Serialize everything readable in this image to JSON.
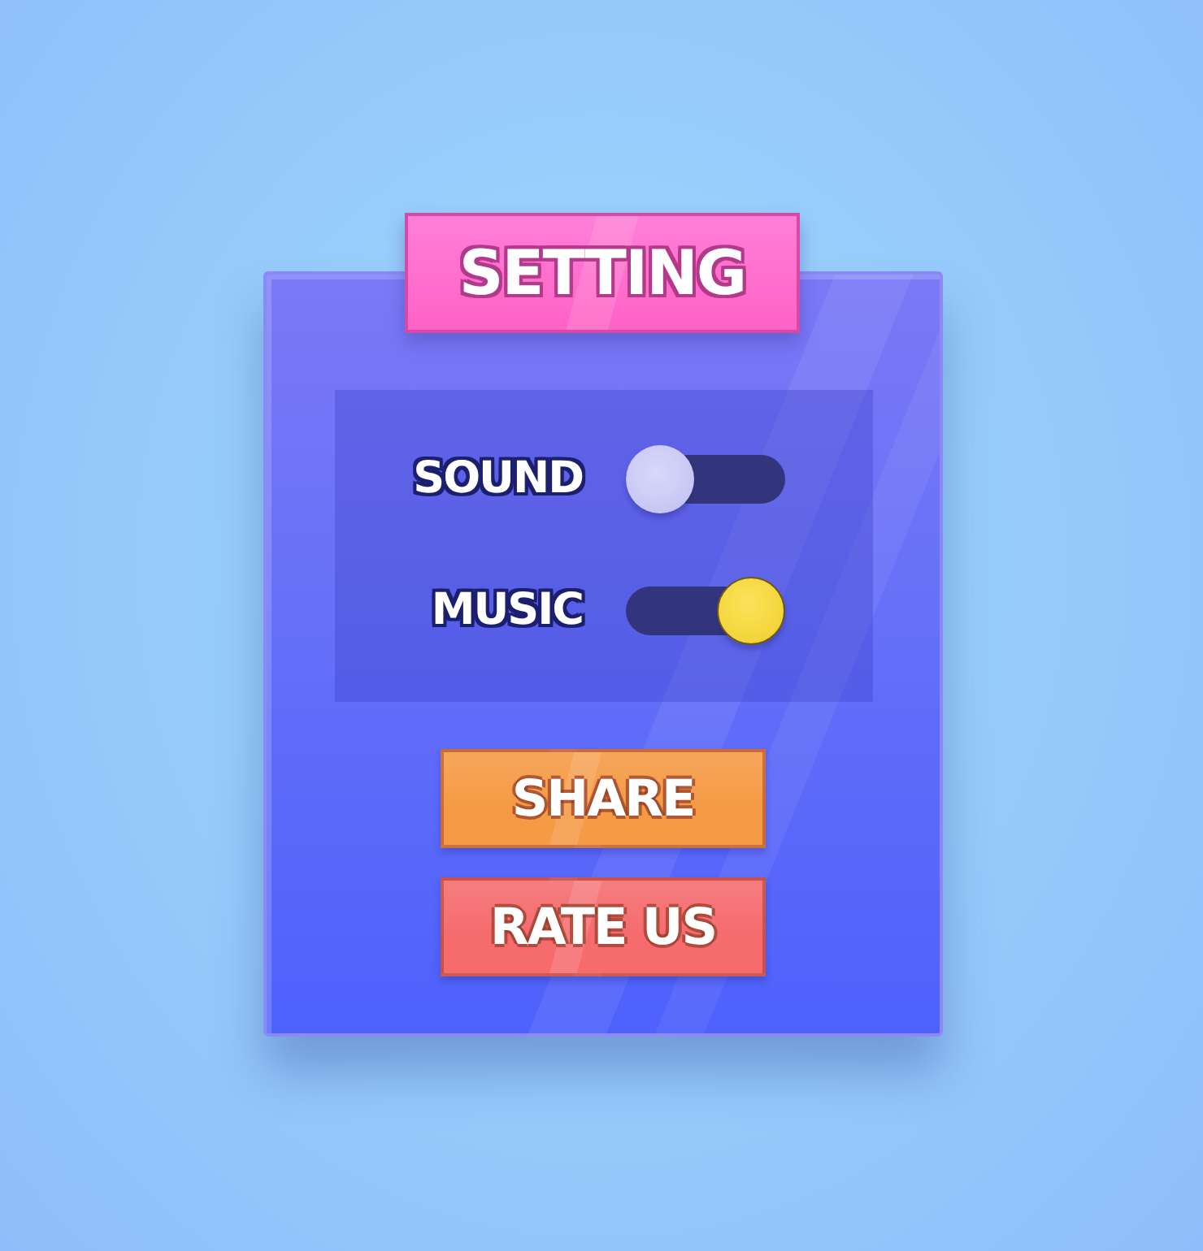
{
  "title": "SETTING",
  "settings": [
    {
      "label": "SOUND",
      "on": false
    },
    {
      "label": "MUSIC",
      "on": true
    }
  ],
  "buttons": [
    {
      "label": "SHARE",
      "color": "#f59a45"
    },
    {
      "label": "RATE US",
      "color": "#f56b6e"
    }
  ]
}
